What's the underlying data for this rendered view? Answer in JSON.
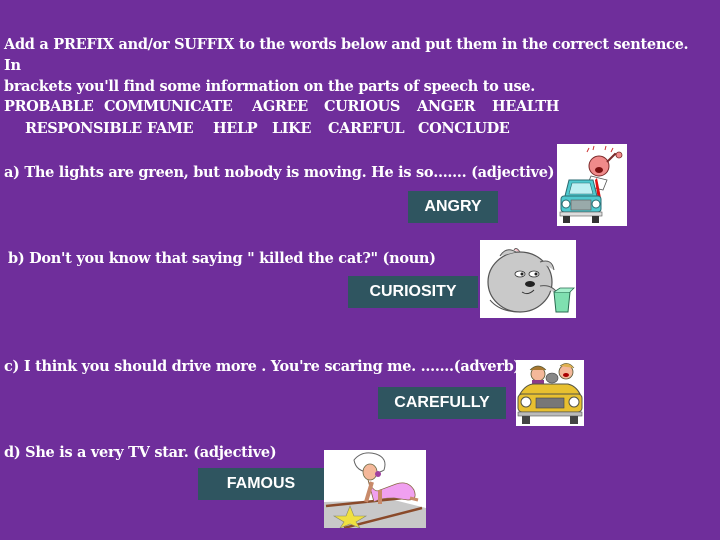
{
  "instructions": {
    "line1": "Add a PREFIX and/or SUFFIX to the words below and put them in the correct sentence. In",
    "line2": "brackets you'll find some information on the parts of speech to use."
  },
  "word_bank": {
    "row1": [
      "PROBABLE",
      "COMMUNICATE",
      "AGREE",
      "CURIOUS",
      "ANGER",
      "HEALTH"
    ],
    "row2": [
      "RESPONSIBLE",
      "FAME",
      "HELP",
      "LIKE",
      "CAREFUL",
      "CONCLUDE"
    ]
  },
  "questions": [
    {
      "text": "a) The lights are green, but nobody is moving. He is so……. (adjective)",
      "answer": "ANGRY",
      "image": "angry-driver-illustration"
    },
    {
      "text": "b) Don't you know that saying \" killed the cat?\"  (noun)",
      "answer": "CURIOSITY",
      "image": "curious-cat-illustration"
    },
    {
      "text": "c) I think you should drive more . You're scaring me. …….(adverb)",
      "answer": "CAREFULLY",
      "image": "scared-passengers-car-illustration"
    },
    {
      "text": "d) She is a very  TV star. (adjective)",
      "answer": "FAMOUS",
      "image": "walk-of-fame-star-illustration"
    }
  ],
  "colors": {
    "background": "#6f2e9b",
    "answer_box": "#2f5560",
    "text": "#ffffff"
  }
}
